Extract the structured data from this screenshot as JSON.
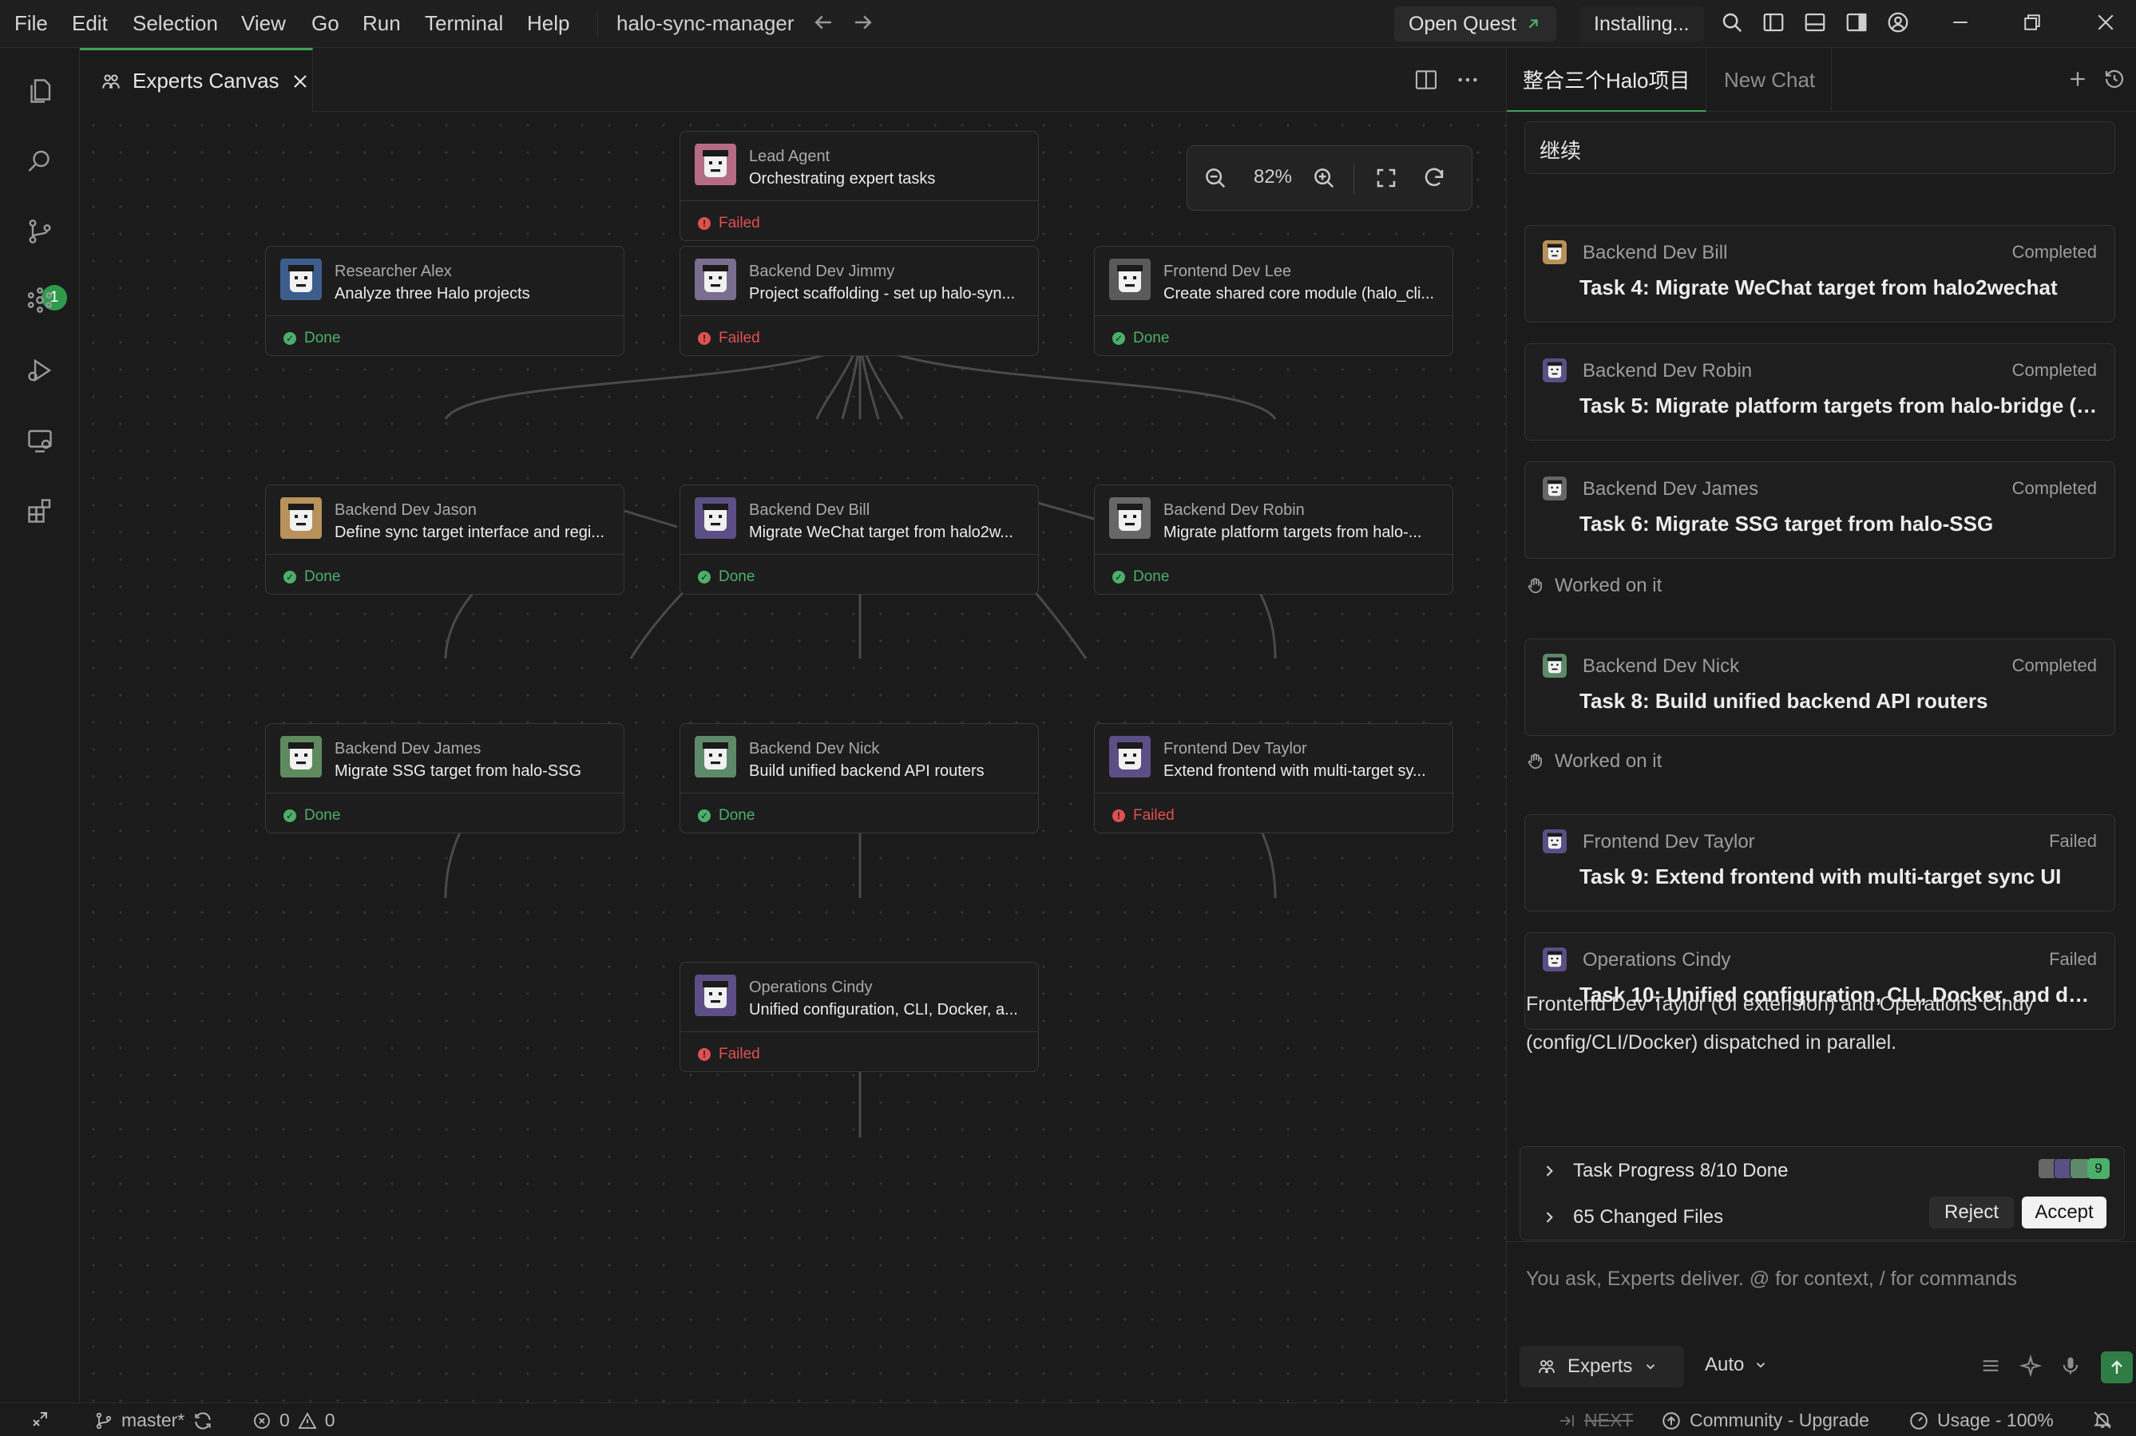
{
  "menu": [
    "File",
    "Edit",
    "Selection",
    "View",
    "Go",
    "Run",
    "Terminal",
    "Help"
  ],
  "project_name": "halo-sync-manager",
  "titlebar": {
    "open_quest": "Open Quest",
    "installing": "Installing..."
  },
  "activity_badge": "1",
  "editor": {
    "tab_label": "Experts Canvas",
    "zoom": "82%"
  },
  "nodes": [
    {
      "id": "lead",
      "role": "Lead Agent",
      "task": "Orchestrating expert tasks",
      "status": "Failed",
      "avatar_color": "#b56b86"
    },
    {
      "id": "alex",
      "role": "Researcher Alex",
      "task": "Analyze three Halo projects",
      "status": "Done",
      "avatar_color": "#3d5e8c"
    },
    {
      "id": "jimmy",
      "role": "Backend Dev Jimmy",
      "task": "Project scaffolding - set up halo-syn...",
      "status": "Failed",
      "avatar_color": "#7a6e8f"
    },
    {
      "id": "lee",
      "role": "Frontend Dev Lee",
      "task": "Create shared core module (halo_cli...",
      "status": "Done",
      "avatar_color": "#5a5a5a"
    },
    {
      "id": "jason",
      "role": "Backend Dev Jason",
      "task": "Define sync target interface and regi...",
      "status": "Done",
      "avatar_color": "#b8925a"
    },
    {
      "id": "bill",
      "role": "Backend Dev Bill",
      "task": "Migrate WeChat target from halo2w...",
      "status": "Done",
      "avatar_color": "#5b4f86"
    },
    {
      "id": "robin",
      "role": "Backend Dev Robin",
      "task": "Migrate platform targets from halo-...",
      "status": "Done",
      "avatar_color": "#676767"
    },
    {
      "id": "james",
      "role": "Backend Dev James",
      "task": "Migrate SSG target from halo-SSG",
      "status": "Done",
      "avatar_color": "#5e8a5e"
    },
    {
      "id": "nick",
      "role": "Backend Dev Nick",
      "task": "Build unified backend API routers",
      "status": "Done",
      "avatar_color": "#5e8a6a"
    },
    {
      "id": "taylor",
      "role": "Frontend Dev Taylor",
      "task": "Extend frontend with multi-target sy...",
      "status": "Failed",
      "avatar_color": "#5b4f86"
    },
    {
      "id": "cindy",
      "role": "Operations Cindy",
      "task": "Unified configuration, CLI, Docker, a...",
      "status": "Failed",
      "avatar_color": "#5b4f86"
    }
  ],
  "chat": {
    "tabs": [
      "整合三个Halo项目",
      "New Chat"
    ],
    "continue_message": "继续",
    "worked_label": "Worked on it",
    "cards": [
      {
        "role": "Backend Dev Bill",
        "status": "Completed",
        "title": "Task 4: Migrate WeChat target from halo2wechat",
        "avatar_color": "#b8925a"
      },
      {
        "role": "Backend Dev Robin",
        "status": "Completed",
        "title": "Task 5: Migrate platform targets from halo-bridge (C...",
        "avatar_color": "#5b4f86"
      },
      {
        "role": "Backend Dev James",
        "status": "Completed",
        "title": "Task 6: Migrate SSG target from halo-SSG",
        "avatar_color": "#676767"
      },
      {
        "role": "Backend Dev Nick",
        "status": "Completed",
        "title": "Task 8: Build unified backend API routers",
        "avatar_color": "#5e8a6a"
      },
      {
        "role": "Frontend Dev Taylor",
        "status": "Failed",
        "title": "Task 9: Extend frontend with multi-target sync UI",
        "avatar_color": "#5b4f86"
      },
      {
        "role": "Operations Cindy",
        "status": "Failed",
        "title": "Task 10: Unified configuration, CLI, Docker, and deplo...",
        "avatar_color": "#5b4f86"
      }
    ],
    "summary": "Frontend Dev Taylor (UI extension) and Operations Cindy (config/CLI/Docker) dispatched in parallel.",
    "progress_label": "Task Progress",
    "progress_value": "8/10 Done",
    "progress_fraction": 0.8,
    "agent_count": "9",
    "changed_files": "65 Changed Files",
    "reject": "Reject",
    "accept": "Accept",
    "input_placeholder": "You ask, Experts deliver. @ for context, / for commands",
    "mode": "Experts",
    "model": "Auto"
  },
  "statusbar": {
    "branch": "master*",
    "errors": "0",
    "warnings": "0",
    "next": "NEXT",
    "community": "Community - Upgrade",
    "usage": "Usage - 100%"
  },
  "colors": {
    "accent": "#3fa35b",
    "done": "#4caf6a",
    "failed": "#e05050"
  }
}
